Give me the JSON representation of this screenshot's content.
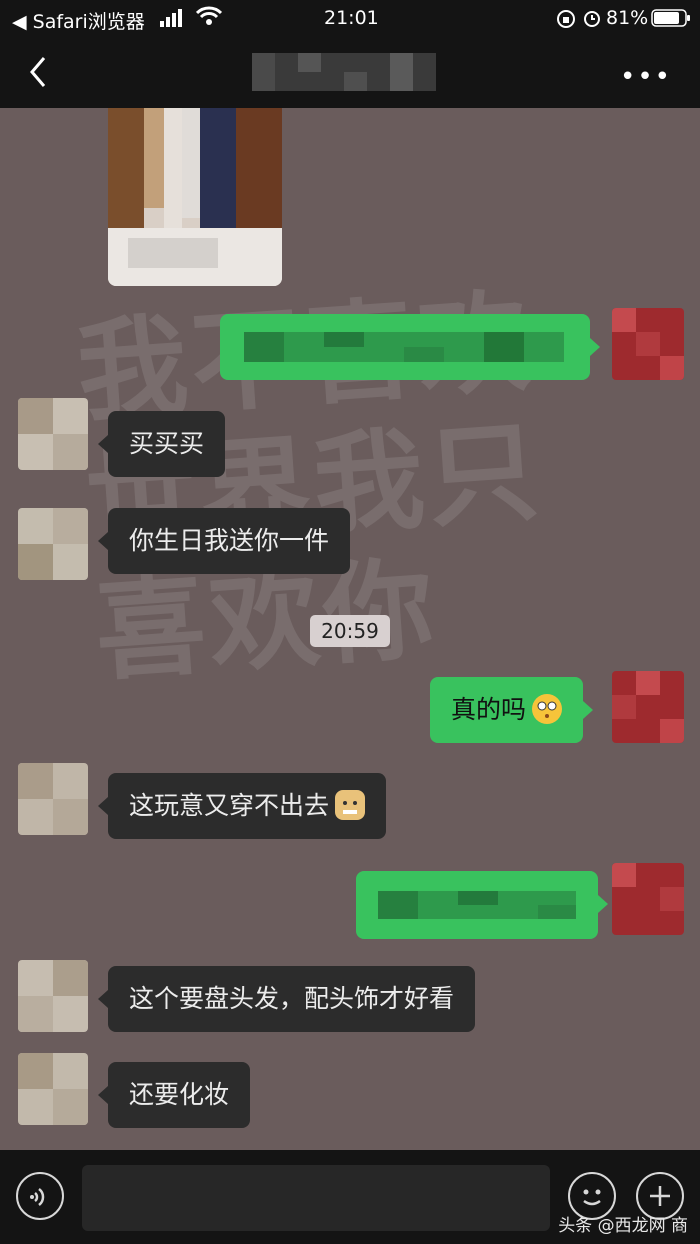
{
  "status_bar": {
    "back_app": "◀ Safari浏览器",
    "time": "21:01",
    "battery": "81%"
  },
  "nav": {
    "more_label": "•••"
  },
  "watermark_text": "我不喜欢世界我只喜欢你",
  "messages": [
    {
      "side": "in",
      "text": "买买买"
    },
    {
      "side": "in",
      "text": "你生日我送你一件"
    },
    {
      "side": "out",
      "text": "真的吗"
    },
    {
      "side": "in",
      "text": "这玩意又穿不出去"
    },
    {
      "side": "in",
      "text": "这个要盘头发，配头饰才好看"
    },
    {
      "side": "in",
      "text": "还要化妆"
    }
  ],
  "timestamp": "20:59",
  "corner_watermark": "头条 @西龙网 商",
  "colors": {
    "chat_bg": "#6a5c5c",
    "bar_bg": "#141414",
    "incoming_bubble": "#2c2c2c",
    "outgoing_bubble": "#39c25e"
  },
  "icons": {
    "back": "chevron-left-icon",
    "more": "ellipsis-icon",
    "voice": "voice-icon",
    "emoji": "emoji-icon",
    "plus": "plus-icon"
  }
}
